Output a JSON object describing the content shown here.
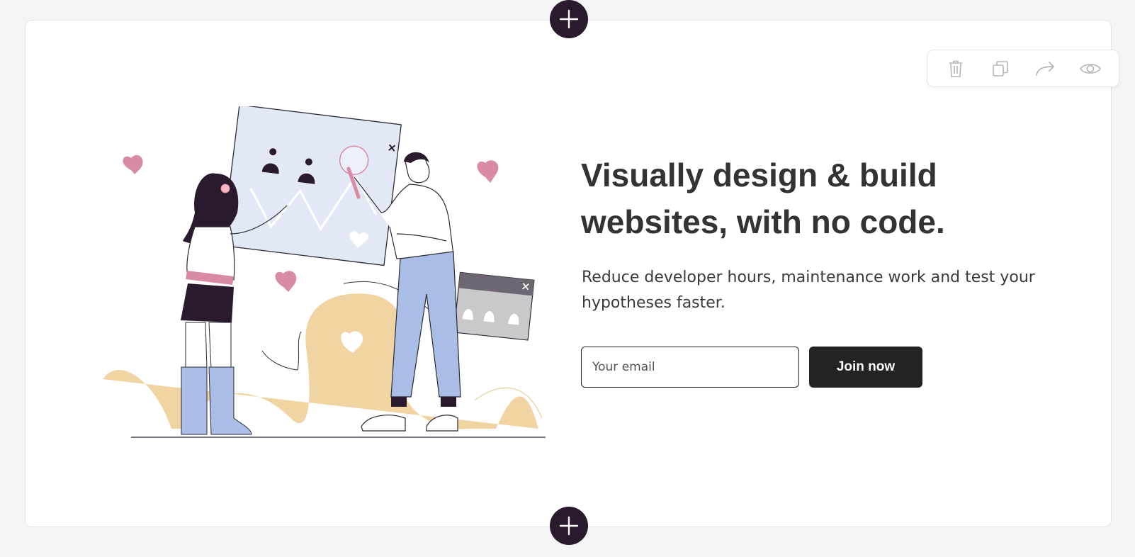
{
  "hero": {
    "headline_line1": "Visually design & build",
    "headline_line2": "websites, with no code.",
    "subtext_line1": "Reduce developer hours, maintenance work and test your",
    "subtext_line2": "hypotheses faster."
  },
  "form": {
    "email_placeholder": "Your email",
    "email_value": "",
    "join_label": "Join now"
  },
  "toolbar": {
    "icons": [
      "trash-icon",
      "copy-icon",
      "share-icon",
      "eye-icon"
    ]
  },
  "colors": {
    "accent_dark": "#2a1a2e",
    "button_bg": "#232323",
    "heart_pink": "#d98aa5",
    "blob_tan": "#f0d5a3",
    "jeans_blue": "#a9bde6",
    "board_blue": "#e2e8f5"
  }
}
